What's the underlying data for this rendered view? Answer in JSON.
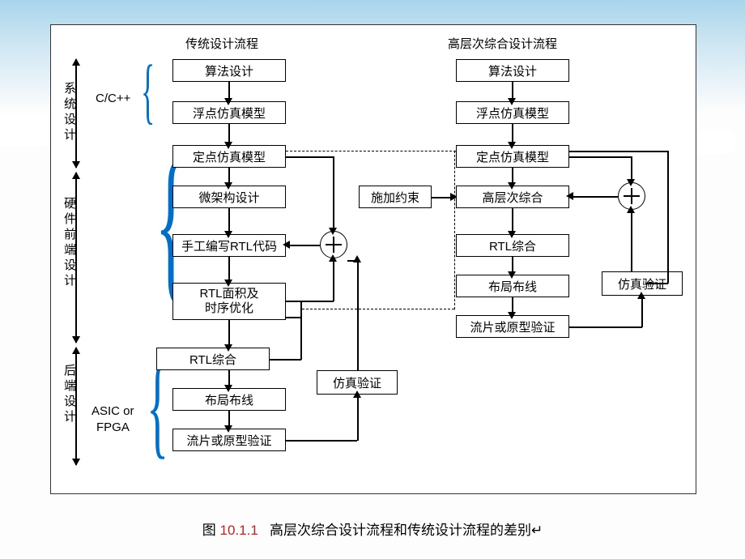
{
  "headers": {
    "left": "传统设计流程",
    "right": "高层次综合设计流程"
  },
  "sections": {
    "sys": "系统设计",
    "hw": "硬件前端设计",
    "back": "后端设计"
  },
  "labels": {
    "cpp": "C/C++",
    "asic": "ASIC or",
    "fpga": "FPGA"
  },
  "left": {
    "b1": "算法设计",
    "b2": "浮点仿真模型",
    "b3": "定点仿真模型",
    "b4": "微架构设计",
    "b5": "手工编写RTL代码",
    "b6a": "RTL面积及",
    "b6b": "时序优化",
    "b7": "RTL综合",
    "b8": "布局布线",
    "b9": "流片或原型验证",
    "sim": "仿真验证"
  },
  "constraint": "施加约束",
  "right": {
    "b1": "算法设计",
    "b2": "浮点仿真模型",
    "b3": "定点仿真模型",
    "b4": "高层次综合",
    "b5": "RTL综合",
    "b6": "布局布线",
    "b7": "流片或原型验证",
    "sim": "仿真验证"
  },
  "caption": {
    "prefix": "图 ",
    "num": "10.1.1",
    "text": "高层次综合设计流程和传统设计流程的差别"
  }
}
